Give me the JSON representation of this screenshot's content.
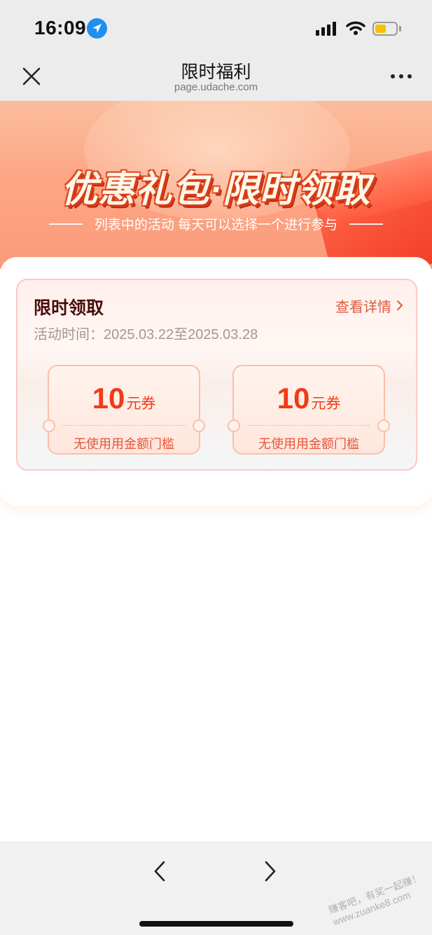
{
  "status": {
    "time": "16:09"
  },
  "nav": {
    "title": "限时福利",
    "url": "page.udache.com"
  },
  "banner": {
    "title": "优惠礼包·限时领取",
    "subtitle": "列表中的活动 每天可以选择一个进行参与"
  },
  "promo": {
    "title": "限时领取",
    "detail_label": "查看详情",
    "time_label": "活动时间：2025.03.22至2025.03.28",
    "coupons": [
      {
        "amount": "10",
        "unit": "元券",
        "condition": "无使用用金额门槛"
      },
      {
        "amount": "10",
        "unit": "元券",
        "condition": "无使用用金额门槛"
      }
    ]
  },
  "watermark": "赚客吧，有奖一起赚！ www.zuanke8.com",
  "colors": {
    "accent": "#f23a16",
    "banner": "#fca685",
    "title_dark": "#4a0d0a"
  }
}
